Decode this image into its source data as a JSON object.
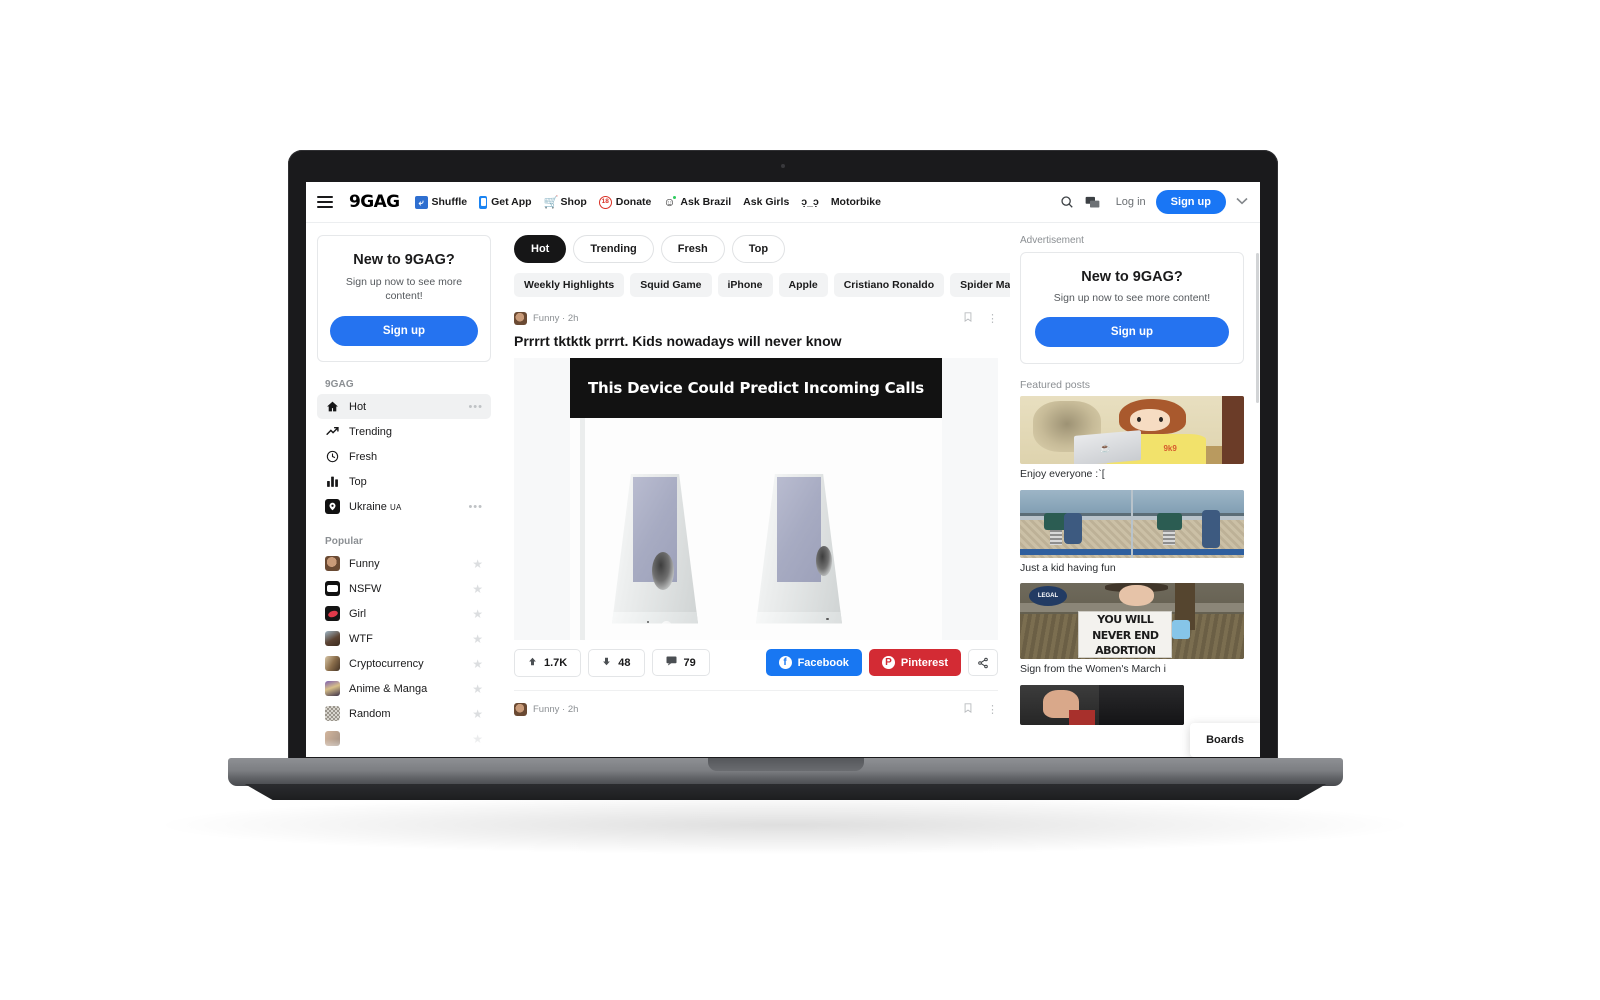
{
  "header": {
    "logo": "9GAG",
    "menu_icon": "hamburger-icon",
    "nav_links": [
      {
        "label": "Shuffle",
        "icon": "shuffle-icon",
        "glyph": "⤨"
      },
      {
        "label": "Get App",
        "icon": "phone-icon",
        "glyph": ""
      },
      {
        "label": "Shop",
        "icon": "shopping-cart-icon",
        "glyph": "🛒"
      },
      {
        "label": "Donate",
        "icon": "donate-badge-icon",
        "glyph": "₴"
      },
      {
        "label": "Ask Brazil",
        "icon": "smiley-icon",
        "glyph": "🙂"
      },
      {
        "label": "Ask Girls",
        "icon": "none",
        "glyph": ""
      },
      {
        "label": "ɔ̣_ɔ̣",
        "icon": "none",
        "glyph": ""
      },
      {
        "label": "Motorbike",
        "icon": "none",
        "glyph": ""
      }
    ],
    "search_icon": "search-icon",
    "chat_icon": "chat-bubble-icon",
    "login_label": "Log in",
    "signup_label": "Sign up",
    "chevron": "⌄",
    "accent_color": "#1976f5"
  },
  "left_sidebar": {
    "signup_card": {
      "title": "New to 9GAG?",
      "subtitle": "Sign up now to see more content!",
      "button_label": "Sign up"
    },
    "section_9gag": {
      "title": "9GAG",
      "items": [
        {
          "label": "Hot",
          "icon": "home-icon",
          "glyph": "⌂",
          "active": true,
          "dots": "•••"
        },
        {
          "label": "Trending",
          "icon": "trending-up-icon",
          "glyph": "↗",
          "active": false,
          "dots": ""
        },
        {
          "label": "Fresh",
          "icon": "clock-icon",
          "glyph": "◴",
          "active": false,
          "dots": ""
        },
        {
          "label": "Top",
          "icon": "bar-chart-icon",
          "glyph": "‖",
          "active": false,
          "dots": ""
        },
        {
          "label": "Ukraine",
          "suffix": "UA",
          "icon": "location-pin-icon",
          "glyph": "◉",
          "active": false,
          "dots": "•••"
        }
      ]
    },
    "section_popular": {
      "title": "Popular",
      "items": [
        {
          "label": "Funny",
          "star": "★"
        },
        {
          "label": "NSFW",
          "star": "★"
        },
        {
          "label": "Girl",
          "star": "★"
        },
        {
          "label": "WTF",
          "star": "★"
        },
        {
          "label": "Cryptocurrency",
          "star": "★"
        },
        {
          "label": "Anime & Manga",
          "star": "★"
        },
        {
          "label": "Random",
          "star": "★"
        }
      ]
    }
  },
  "feed": {
    "tabs": [
      {
        "label": "Hot",
        "active": true
      },
      {
        "label": "Trending",
        "active": false
      },
      {
        "label": "Fresh",
        "active": false
      },
      {
        "label": "Top",
        "active": false
      }
    ],
    "topic_chips": [
      "Weekly Highlights",
      "Squid Game",
      "iPhone",
      "Apple",
      "Cristiano Ronaldo",
      "Spider Man"
    ],
    "post": {
      "section": "Funny",
      "separator": "·",
      "age": "2h",
      "meta_line": "Funny · 2h",
      "save_icon": "bookmark-icon",
      "more_icon": "more-vertical-icon",
      "title": "Prrrrt tktktk prrrt. Kids nowadays will never know",
      "media_caption": "This Device Could Predict Incoming Calls",
      "upvotes": "1.7K",
      "downvotes": "48",
      "comments": "79",
      "upvote_icon": "arrow-up-icon",
      "downvote_icon": "arrow-down-icon",
      "comment_icon": "comment-icon",
      "facebook_label": "Facebook",
      "pinterest_label": "Pinterest",
      "share_icon": "share-icon",
      "facebook_color": "#1877f2",
      "pinterest_color": "#d32b34"
    },
    "next_post": {
      "meta_line": "Funny · 2h",
      "save_icon": "bookmark-icon",
      "more_icon": "more-vertical-icon"
    }
  },
  "right_sidebar": {
    "advertisement_label": "Advertisement",
    "ad_card": {
      "title": "New to 9GAG?",
      "subtitle": "Sign up now to see more content!",
      "button_label": "Sign up"
    },
    "featured_label": "Featured posts",
    "featured_posts": [
      {
        "caption": "Enjoy everyone :`["
      },
      {
        "caption": "Just a kid having fun"
      },
      {
        "caption": "Sign from the Women's March i"
      },
      {
        "caption": ""
      }
    ],
    "tooltip": "Boards",
    "sign_text": {
      "line1": "YOU WILL",
      "line2": "NEVER END",
      "line3": "ABORTION",
      "badge": "LEGAL"
    }
  }
}
